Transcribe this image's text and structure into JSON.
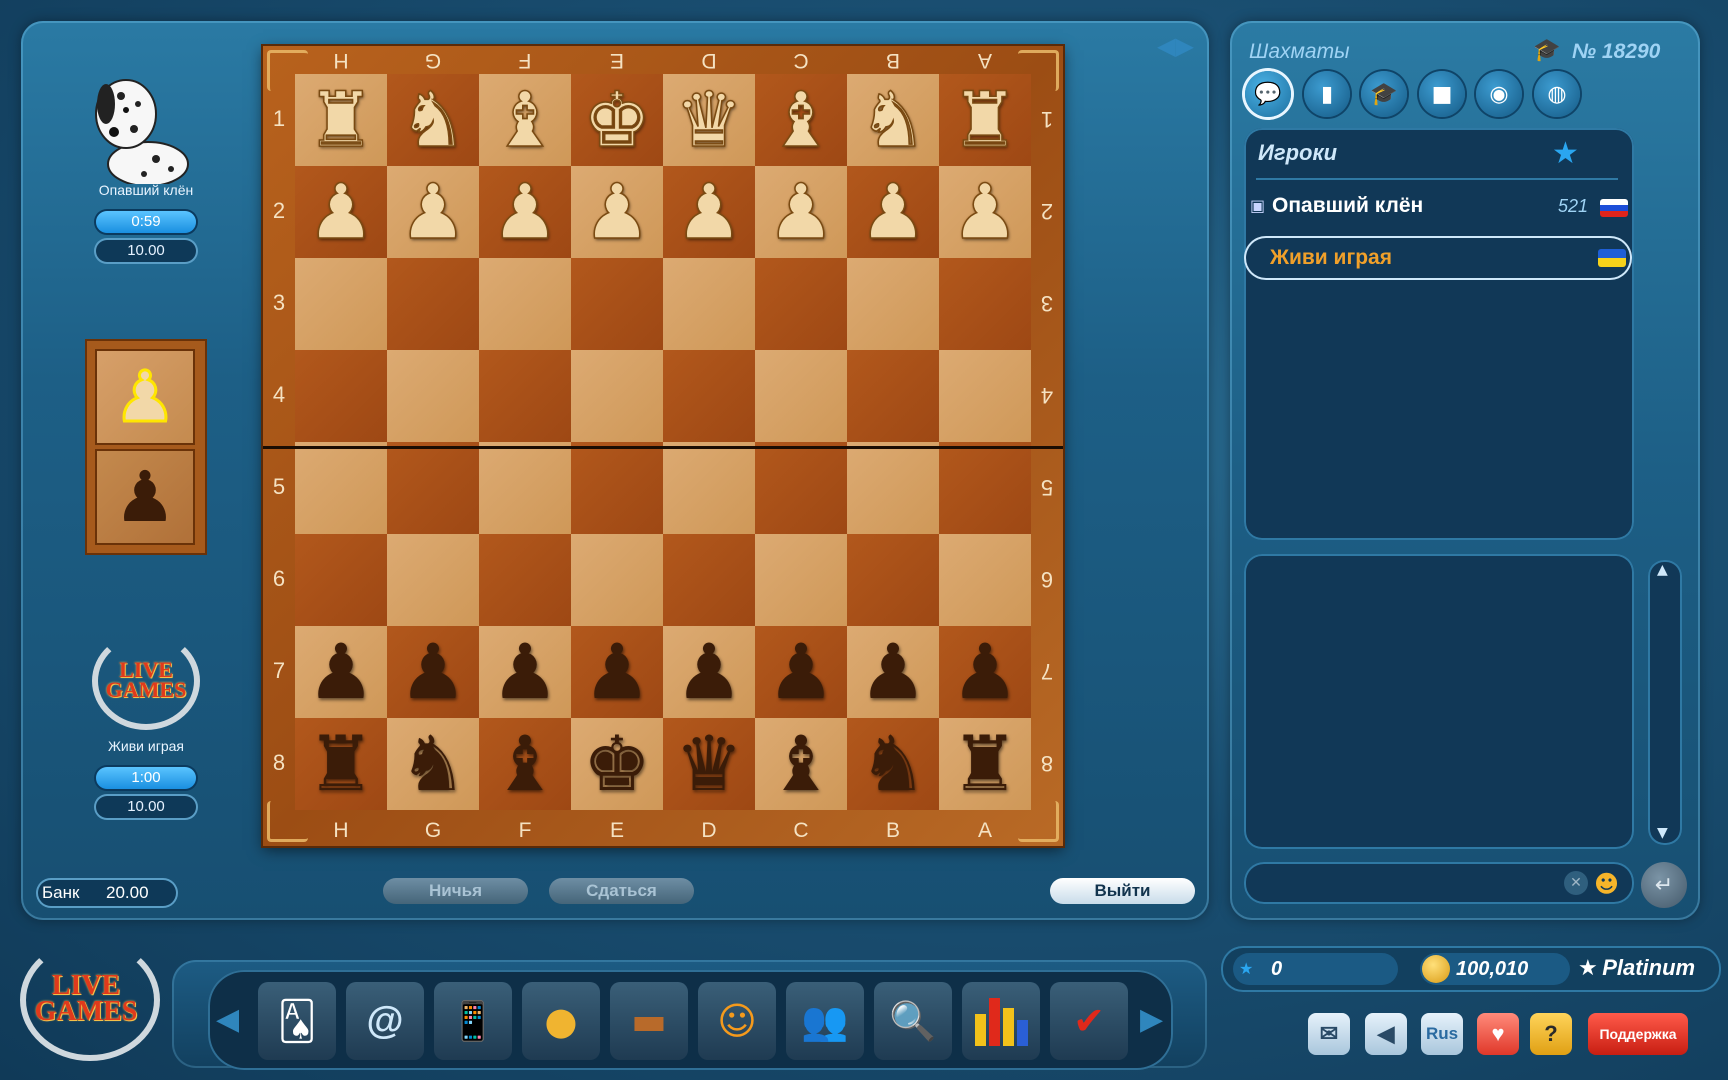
{
  "game": {
    "title": "Шахматы",
    "number": "№ 18290"
  },
  "top_player": {
    "name": "Опавший клён",
    "timer": "0:59",
    "total": "10.00",
    "avatar": "dalmatian-dog"
  },
  "bottom_player": {
    "name": "Живи играя",
    "timer": "1:00",
    "total": "10.00",
    "avatar": "live-games-logo"
  },
  "bank": {
    "label": "Банк",
    "value": "20.00"
  },
  "buttons": {
    "draw": "Ничья",
    "resign": "Сдаться",
    "exit": "Выйти"
  },
  "board": {
    "files": [
      "H",
      "G",
      "F",
      "E",
      "D",
      "C",
      "B",
      "A"
    ],
    "ranks": [
      "1",
      "2",
      "3",
      "4",
      "5",
      "6",
      "7",
      "8"
    ],
    "rows": [
      [
        "wR",
        "wN",
        "wB",
        "wK",
        "wQ",
        "wB",
        "wN",
        "wR"
      ],
      [
        "wP",
        "wP",
        "wP",
        "wP",
        "wP",
        "wP",
        "wP",
        "wP"
      ],
      [
        "",
        "",
        "",
        "",
        "",
        "",
        "",
        ""
      ],
      [
        "",
        "",
        "",
        "",
        "",
        "",
        "",
        ""
      ],
      [
        "",
        "",
        "",
        "",
        "",
        "",
        "",
        ""
      ],
      [
        "",
        "",
        "",
        "",
        "",
        "",
        "",
        ""
      ],
      [
        "bP",
        "bP",
        "bP",
        "bP",
        "bP",
        "bP",
        "bP",
        "bP"
      ],
      [
        "bR",
        "bN",
        "bB",
        "bK",
        "bQ",
        "bB",
        "bN",
        "bR"
      ]
    ],
    "colors": {
      "light": "#dcaa72",
      "dark": "#b2581c",
      "frame": "#a9571a"
    }
  },
  "turn_indicator": {
    "top": "white-pawn",
    "bottom": "black-pawn",
    "active": "top"
  },
  "sidebar": {
    "tabs": [
      "chat-icon",
      "stats-icon",
      "graduation-cap-icon",
      "video-icon",
      "camera-icon",
      "globe-icon"
    ],
    "players_header": "Игроки",
    "players": [
      {
        "name": "Опавший клён",
        "rating": "521",
        "flag": "russia",
        "highlight": false
      },
      {
        "name": "Живи играя",
        "rating": "",
        "flag": "ukraine",
        "highlight": true
      }
    ]
  },
  "status": {
    "stars": "0",
    "coins": "100,010",
    "level": "Platinum"
  },
  "footer_buttons": {
    "lang": "Rus",
    "support": "Поддержка"
  },
  "dock_icons": [
    "cards-billiard-icon",
    "mail-100-icon",
    "phone-1000-icon",
    "coin-clock-icon",
    "wallet-icon",
    "masks-icon",
    "people-icon",
    "magnifier-icon",
    "bar-chart-icon",
    "checkmark-icon"
  ]
}
